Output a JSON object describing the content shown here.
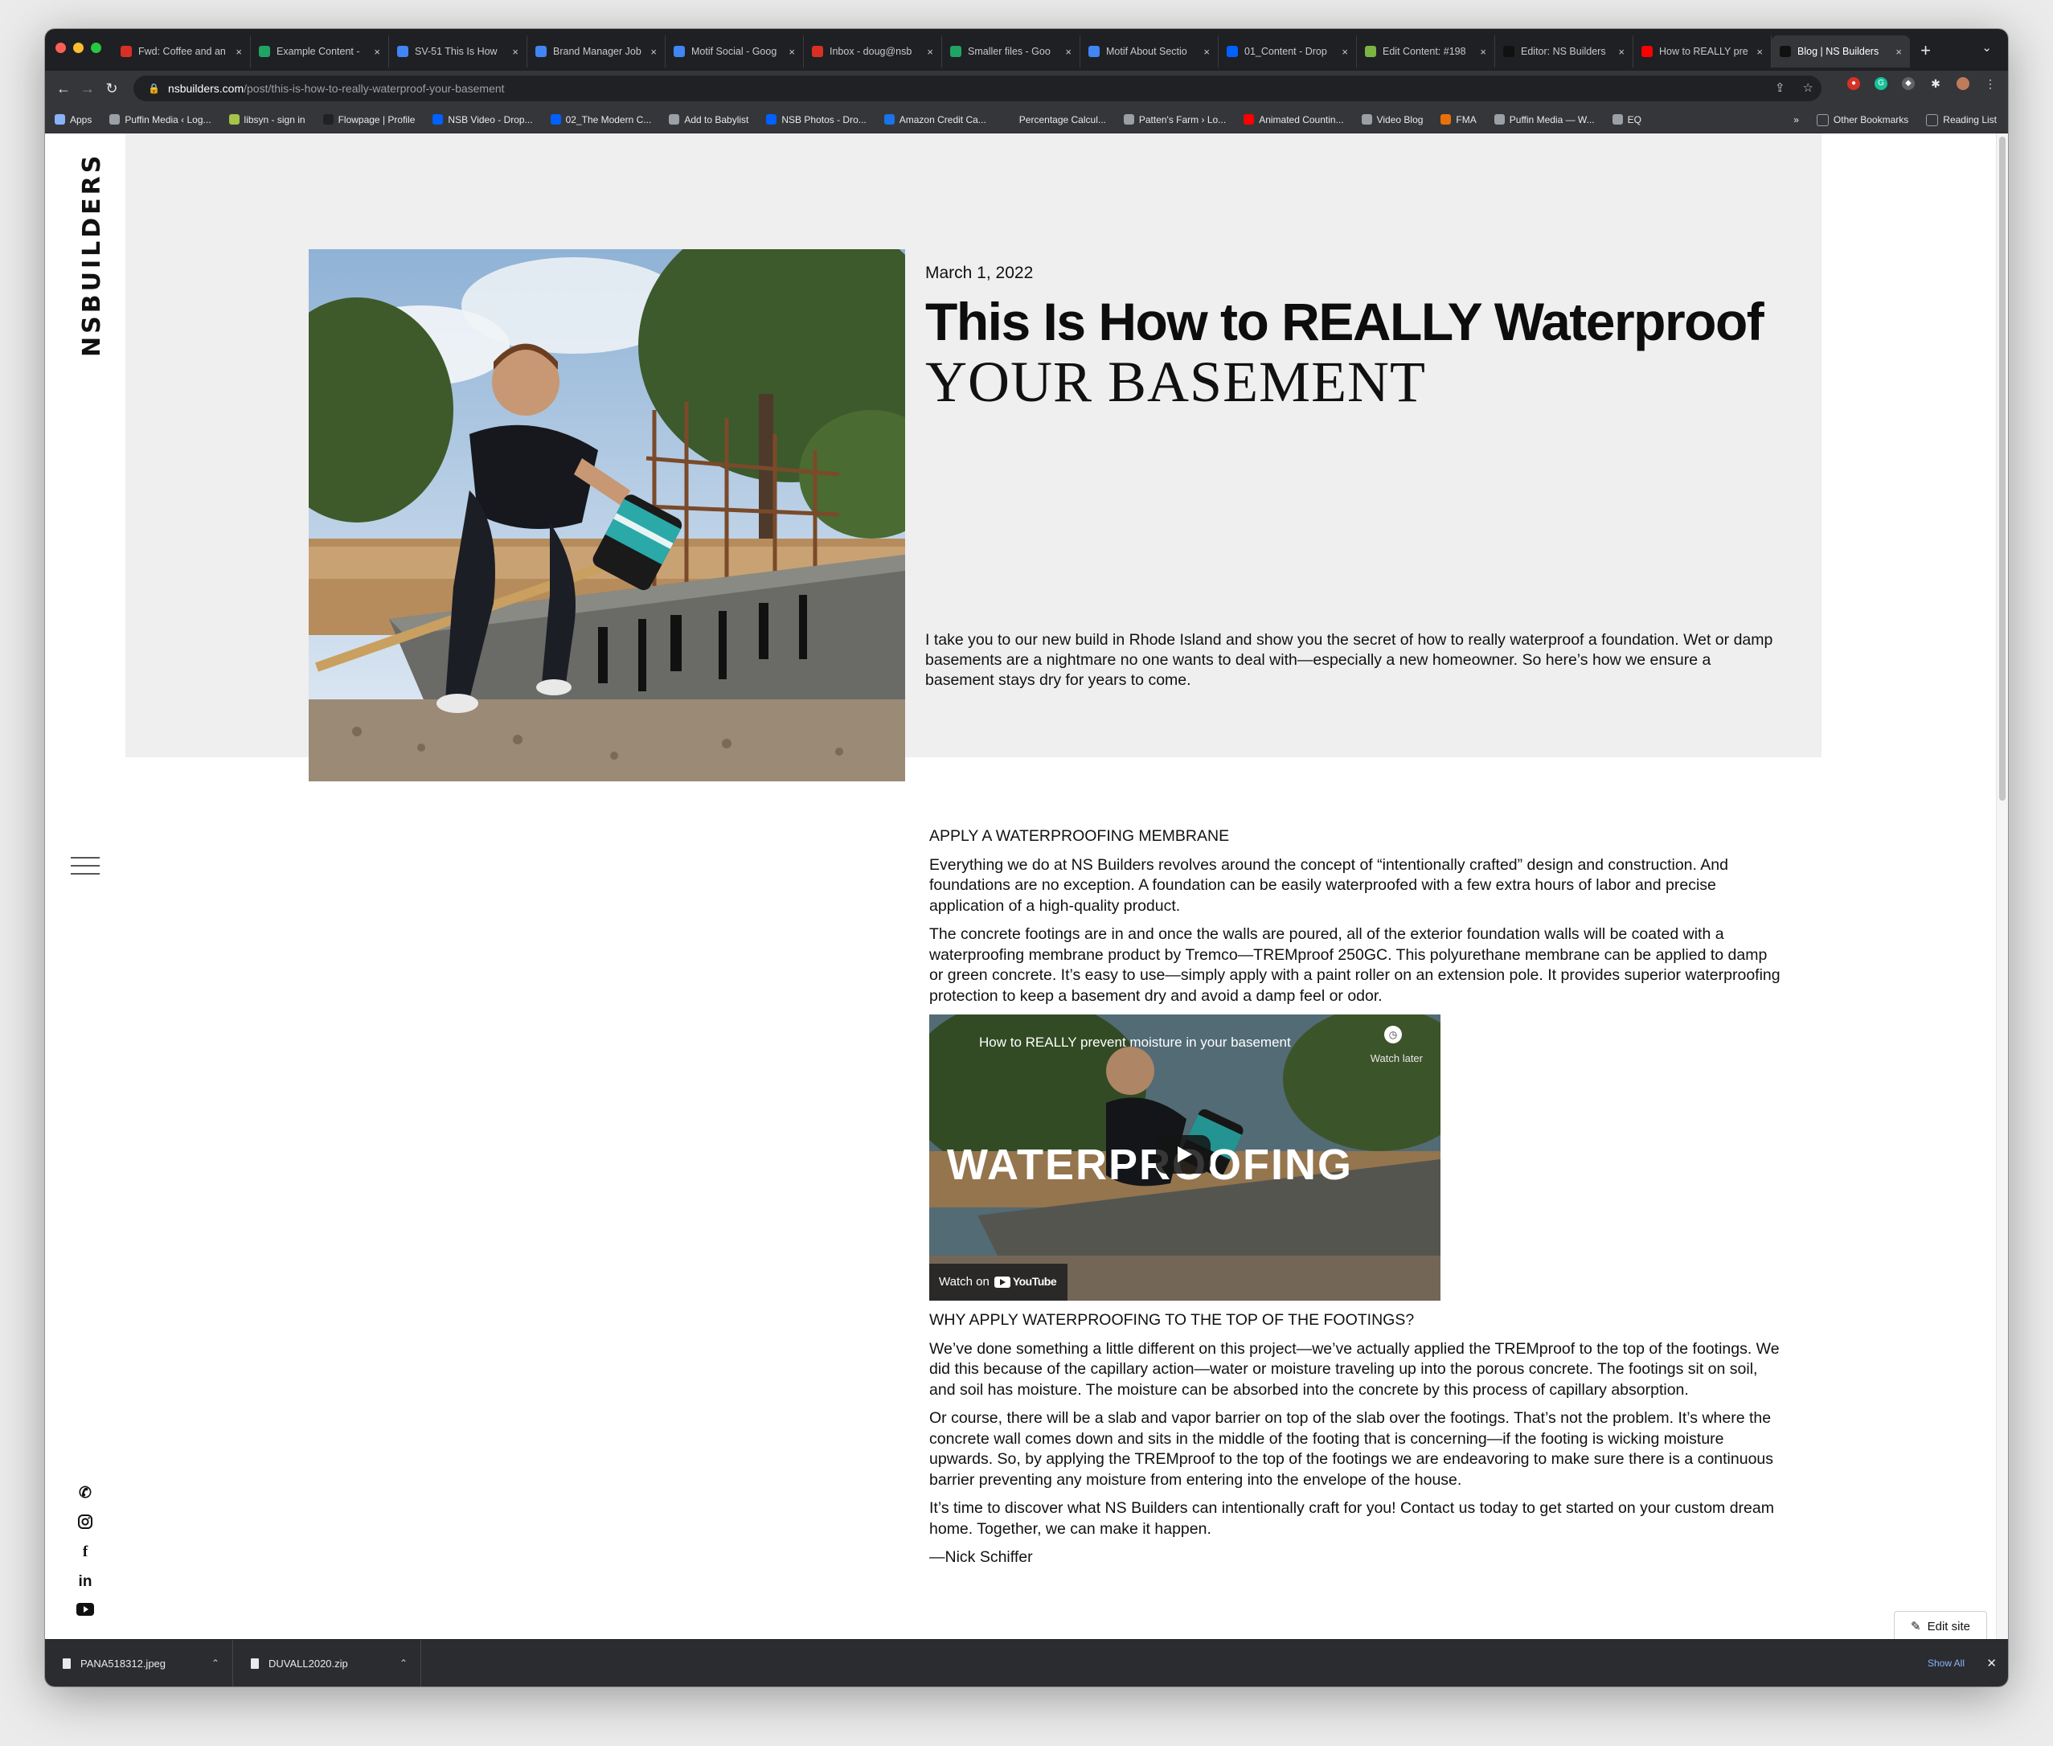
{
  "browser": {
    "tabs": [
      {
        "title": "Fwd: Coffee and an",
        "favicon": "gmail",
        "color": "#d93025"
      },
      {
        "title": "Example Content -",
        "favicon": "drive",
        "color": "#1fa463"
      },
      {
        "title": "SV-51 This Is How",
        "favicon": "docs",
        "color": "#4285f4"
      },
      {
        "title": "Brand Manager Job",
        "favicon": "docs",
        "color": "#4285f4"
      },
      {
        "title": "Motif Social - Goog",
        "favicon": "docs",
        "color": "#4285f4"
      },
      {
        "title": "Inbox - doug@nsb",
        "favicon": "gmail",
        "color": "#d93025"
      },
      {
        "title": "Smaller files - Goo",
        "favicon": "drive",
        "color": "#1fa463"
      },
      {
        "title": "Motif About Sectio",
        "favicon": "docs",
        "color": "#4285f4"
      },
      {
        "title": "01_Content - Drop",
        "favicon": "dropbox",
        "color": "#0061fe"
      },
      {
        "title": "Edit Content: #198",
        "favicon": "leaf",
        "color": "#7cb342"
      },
      {
        "title": "Editor: NS Builders",
        "favicon": "nsb",
        "color": "#111111"
      },
      {
        "title": "How to REALLY pre",
        "favicon": "youtube",
        "color": "#ff0000"
      },
      {
        "title": "Blog | NS Builders",
        "favicon": "nsb",
        "color": "#111111",
        "active": true
      }
    ],
    "address": {
      "host": "nsbuilders.com",
      "path": "/post/this-is-how-to-really-waterproof-your-basement"
    },
    "bookmarks": [
      {
        "label": "Apps",
        "color": "#8ab4f8"
      },
      {
        "label": "Puffin Media ‹ Log...",
        "color": "#9aa0a6"
      },
      {
        "label": "libsyn - sign in",
        "color": "#a6c34a"
      },
      {
        "label": "Flowpage | Profile",
        "color": "#202124"
      },
      {
        "label": "NSB Video - Drop...",
        "color": "#0061fe"
      },
      {
        "label": "02_The Modern C...",
        "color": "#0061fe"
      },
      {
        "label": "Add to Babylist",
        "color": "#9aa0a6"
      },
      {
        "label": "NSB Photos - Dro...",
        "color": "#0061fe"
      },
      {
        "label": "Amazon Credit Ca...",
        "color": "#1a73e8"
      },
      {
        "label": "Percentage Calcul...",
        "color": "#35363a"
      },
      {
        "label": "Patten's Farm › Lo...",
        "color": "#9aa0a6"
      },
      {
        "label": "Animated Countin...",
        "color": "#ff0000"
      },
      {
        "label": "Video Blog",
        "color": "#9aa0a6"
      },
      {
        "label": "FMA",
        "color": "#e8710a"
      },
      {
        "label": "Puffin Media — W...",
        "color": "#9aa0a6"
      },
      {
        "label": "EQ",
        "color": "#9aa0a6"
      }
    ],
    "bookmarks_right": {
      "other": "Other Bookmarks",
      "reading": "Reading List",
      "more": "»"
    }
  },
  "site": {
    "logo_text": "NSBUILDERS",
    "post": {
      "date": "March 1, 2022",
      "title_line1": "This Is How to REALLY Waterproof",
      "title_line2": "YOUR BASEMENT",
      "intro": "I take you to our new build in Rhode Island and show you the secret of how to really waterproof a foundation. Wet or damp basements are a nightmare no one wants to deal with—especially a new homeowner. So here’s how we ensure a basement stays dry for years to come.",
      "section1_heading": "APPLY A WATERPROOFING MEMBRANE",
      "section1_p1": "Everything we do at NS Builders revolves around the concept of “intentionally crafted” design and construction. And foundations are no exception. A foundation can be easily waterproofed with a few extra hours of labor and precise application of a high-quality product.",
      "section1_p2": "The concrete footings are in and once the walls are poured, all of the exterior foundation walls will be coated with a waterproofing membrane product by Tremco—TREMproof 250GC. This polyurethane membrane can be applied to damp or green concrete. It’s easy to use—simply apply with a paint roller on an extension pole. It provides superior waterproofing protection to keep a basement dry and avoid a damp feel or odor.",
      "video": {
        "title": "How to REALLY prevent moisture in your basement",
        "watch_later": "Watch later",
        "overlay_text": "WATERPROOFING",
        "watch_on": "Watch on",
        "youtube": "YouTube"
      },
      "section2_heading": "WHY APPLY WATERPROOFING TO THE TOP OF THE FOOTINGS?",
      "section2_p1": "We’ve done something a little different on this project—we’ve actually applied the TREMproof to the top of the footings. We did this because of the capillary action—water or moisture traveling up into the porous concrete. The footings sit on soil, and soil has moisture. The moisture can be absorbed into the concrete by this process of capillary absorption.",
      "section2_p2": "Or course, there will be a slab and vapor barrier on top of the slab over the footings. That’s not the problem. It’s where the concrete wall comes down and sits in the middle of the footing that is concerning—if the footing is wicking moisture upwards. So, by applying the TREMproof to the top of the footings we are endeavoring to make sure there is a continuous barrier preventing any moisture from entering into the envelope of the house.",
      "closing": "It’s time to discover what NS Builders can intentionally craft for you! Contact us today to get started on your custom dream home. Together, we can make it happen.",
      "signature": "—Nick Schiffer"
    },
    "edit_site": "Edit site",
    "social_icons": [
      "phone-icon",
      "instagram-icon",
      "facebook-icon",
      "linkedin-icon",
      "youtube-icon"
    ]
  },
  "downloads": {
    "items": [
      "PANA518312.jpeg",
      "DUVALL2020.zip"
    ],
    "show_all": "Show All"
  }
}
